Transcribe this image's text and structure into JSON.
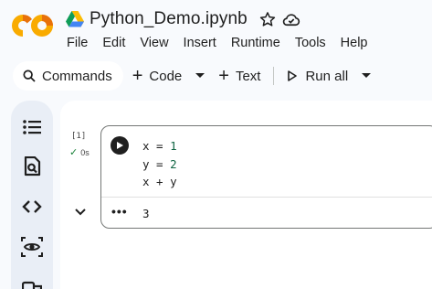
{
  "app": {
    "logo_text": "CO",
    "logo_colors": [
      "#f9ab00",
      "#e8710a"
    ]
  },
  "notebook": {
    "title": "Python_Demo.ipynb"
  },
  "menu": [
    "File",
    "Edit",
    "View",
    "Insert",
    "Runtime",
    "Tools",
    "Help"
  ],
  "toolbar": {
    "commands_label": "Commands",
    "code_label": "Code",
    "text_label": "Text",
    "run_all_label": "Run all"
  },
  "sidebar_icons": [
    "table-of-contents-icon",
    "find-icon",
    "code-snippets-icon",
    "variables-icon",
    "secrets-icon"
  ],
  "cell": {
    "execution_count": "[1]",
    "execution_time": "0s",
    "code_lines": [
      {
        "var": "x",
        "op": " = ",
        "val": "1"
      },
      {
        "var": "y",
        "op": " = ",
        "val": "2"
      },
      {
        "var": "x",
        "op": " + ",
        "val": "y"
      }
    ],
    "output": "3"
  },
  "colors": {
    "accent": "#0b57d0",
    "success": "#188038",
    "background": "#f8fafd",
    "sidebar": "#e9eef6"
  }
}
